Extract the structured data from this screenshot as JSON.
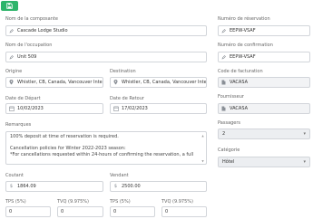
{
  "toolbar": {
    "save_icon": "save-icon"
  },
  "labels": {
    "component_name": "Nom de la composante",
    "reservation_number": "Numéro de réservation",
    "occupation_name": "Nom de l'occupation",
    "confirmation_number": "Numéro de confirmation",
    "origin": "Origine",
    "destination": "Destination",
    "billing_code": "Code de facturation",
    "departure_date": "Date de Départ",
    "return_date": "Date de Retour",
    "supplier": "Fournisseur",
    "remarks": "Remarques",
    "passengers": "Passagers",
    "category": "Catégorie",
    "cost": "Coutant",
    "selling": "Vendant",
    "tps_cost": "TPS (5%)",
    "tvq_cost": "TVQ (9.975%)",
    "tps_sell": "TPS (5%)",
    "tvq_sell": "TVQ (9.975%)"
  },
  "values": {
    "component_name": "Cascade Lodge Studio",
    "reservation_number": "EEPW-VSAF",
    "occupation_name": "Unit 509",
    "confirmation_number": "EEPW-VSAF",
    "origin": "Whistler, CB, Canada, Vancouver Inte",
    "destination": "Whistler, CB, Canada, Vancouver Inte",
    "billing_code": "VACASA",
    "departure_date": "10/02/2023",
    "return_date": "17/02/2023",
    "supplier": "VACASA",
    "remarks_lines": [
      "100% deposit at time of reservation is required.",
      "",
      "Cancellation policies for Winter 2022-2023 season:",
      "*For cancellations requested within 24-hours of confirming the reservation, a full"
    ],
    "passengers": "2",
    "category": "Hôtel",
    "cost": "1864.09",
    "selling": "2500.00",
    "tps_cost": "0",
    "tvq_cost": "0",
    "tps_sell": "0",
    "tvq_sell": "0"
  },
  "symbols": {
    "currency": "$",
    "scroll_up": "▲",
    "scroll_down": "▼",
    "chevron": "▾"
  },
  "colors": {
    "save_button": "#2db46a"
  }
}
